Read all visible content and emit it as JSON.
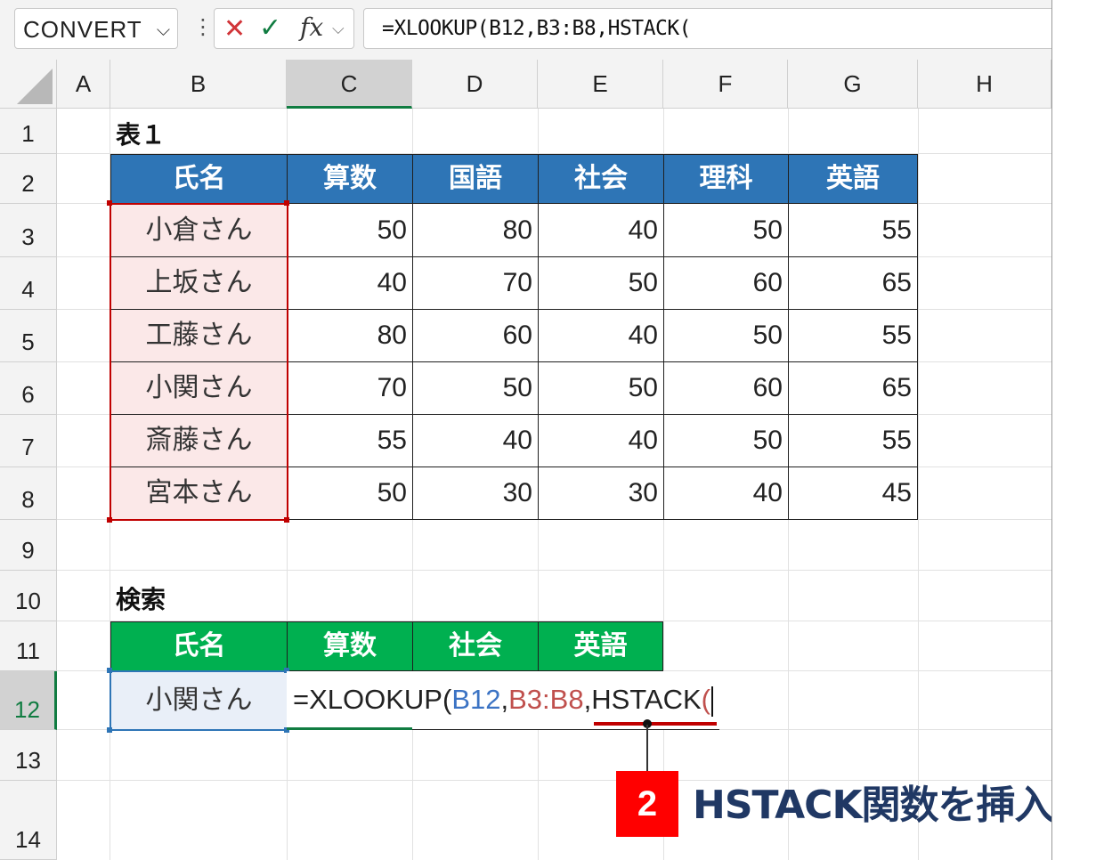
{
  "formula_bar": {
    "name_box": "CONVERT",
    "cancel_icon": "close-icon",
    "enter_icon": "check-icon",
    "fx_label": "fx",
    "formula": "=XLOOKUP(B12,B3:B8,HSTACK("
  },
  "columns": [
    "A",
    "B",
    "C",
    "D",
    "E",
    "F",
    "G",
    "H"
  ],
  "rows": [
    "1",
    "2",
    "3",
    "4",
    "5",
    "6",
    "7",
    "8",
    "9",
    "10",
    "11",
    "12",
    "13",
    "14"
  ],
  "table1": {
    "title": "表１",
    "headers": [
      "氏名",
      "算数",
      "国語",
      "社会",
      "理科",
      "英語"
    ],
    "rows": [
      {
        "name": "小倉さん",
        "values": [
          "50",
          "80",
          "40",
          "50",
          "55"
        ]
      },
      {
        "name": "上坂さん",
        "values": [
          "40",
          "70",
          "50",
          "60",
          "65"
        ]
      },
      {
        "name": "工藤さん",
        "values": [
          "80",
          "60",
          "40",
          "50",
          "55"
        ]
      },
      {
        "name": "小関さん",
        "values": [
          "70",
          "50",
          "50",
          "60",
          "65"
        ]
      },
      {
        "name": "斎藤さん",
        "values": [
          "55",
          "40",
          "40",
          "50",
          "55"
        ]
      },
      {
        "name": "宮本さん",
        "values": [
          "50",
          "30",
          "30",
          "40",
          "45"
        ]
      }
    ]
  },
  "search": {
    "title": "検索",
    "headers": [
      "氏名",
      "算数",
      "社会",
      "英語"
    ],
    "name_value": "小関さん"
  },
  "editing": {
    "prefix": "=XLOOKUP(",
    "ref1": "B12",
    "comma1": ",",
    "ref2": "B3:B8",
    "comma2": ",",
    "func": "HSTACK",
    "paren": "("
  },
  "annotation": {
    "step": "2",
    "text": "HSTACK関数を挿入"
  }
}
